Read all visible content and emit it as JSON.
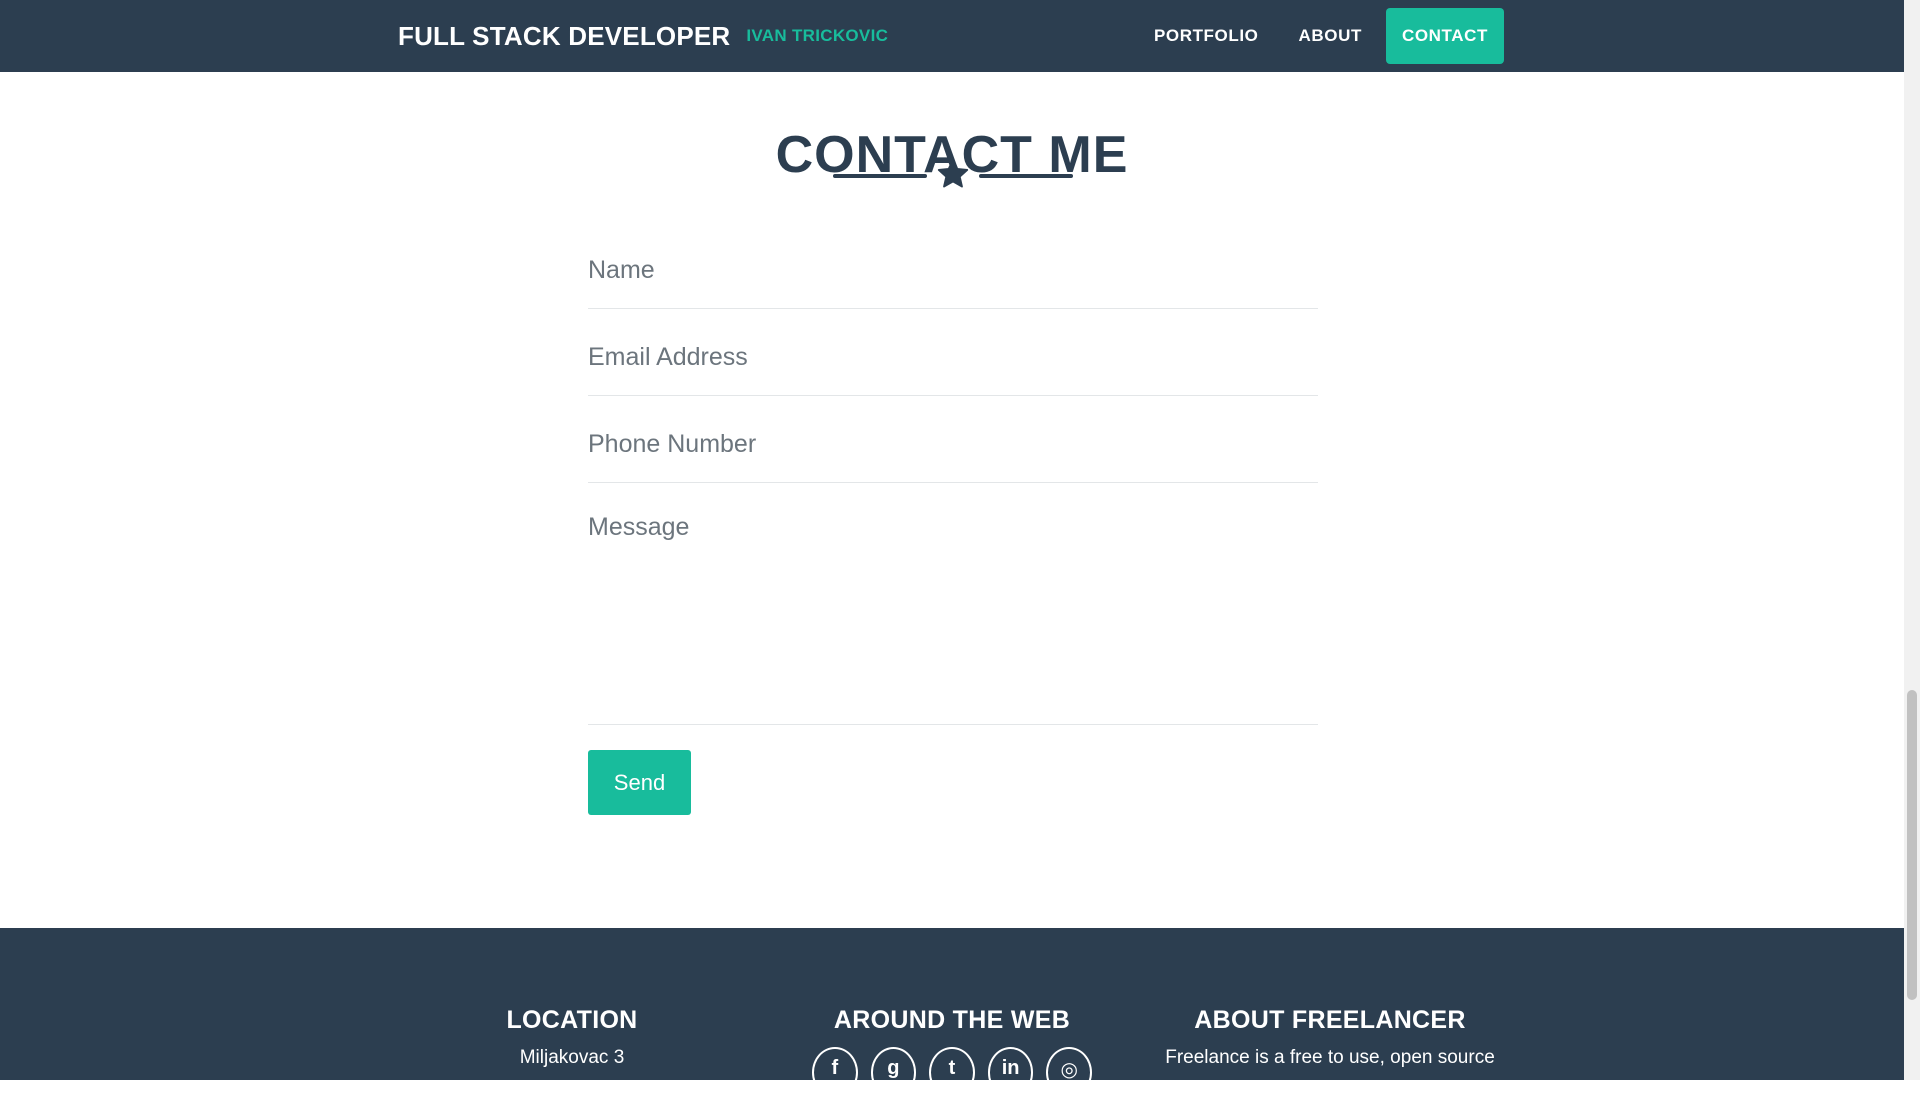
{
  "navbar": {
    "brand_title": "FULL STACK DEVELOPER",
    "brand_subtitle": "IVAN TRICKOVIC",
    "links": [
      {
        "label": "PORTFOLIO",
        "active": false
      },
      {
        "label": "ABOUT",
        "active": false
      },
      {
        "label": "CONTACT",
        "active": true
      }
    ]
  },
  "contact": {
    "title": "CONTACT ME",
    "divider_icon": "star-icon",
    "fields": {
      "name_placeholder": "Name",
      "email_placeholder": "Email Address",
      "phone_placeholder": "Phone Number",
      "message_placeholder": "Message"
    },
    "send_label": "Send"
  },
  "footer": {
    "location_title": "LOCATION",
    "location_text": "Miljakovac 3",
    "web_title": "AROUND THE WEB",
    "social_icons": [
      "facebook-icon",
      "google-plus-icon",
      "twitter-icon",
      "linkedin-icon",
      "dribbble-icon"
    ],
    "about_title": "ABOUT FREELANCER",
    "about_text": "Freelance is a free to use, open source"
  },
  "colors": {
    "primary": "#2c3e50",
    "accent": "#18bc9c",
    "white": "#ffffff"
  }
}
